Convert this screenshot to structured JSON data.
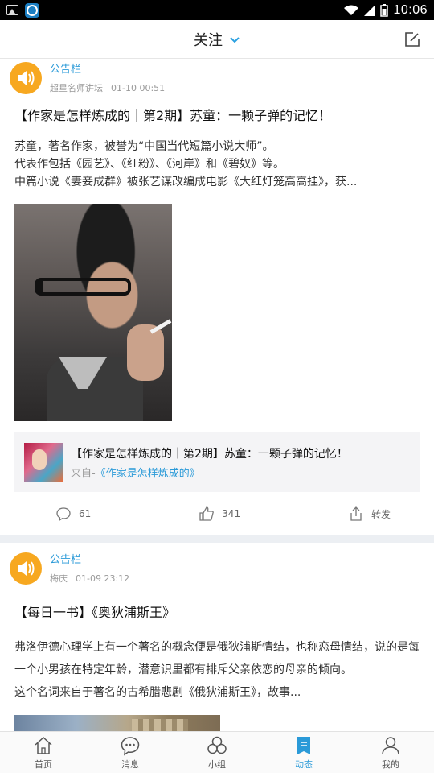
{
  "status_bar": {
    "time": "10:06"
  },
  "header": {
    "title": "关注"
  },
  "posts": [
    {
      "channel": "公告栏",
      "author": "超星名师讲坛",
      "time": "01-10 00:51",
      "title": "【作家是怎样炼成的｜第2期】苏童：一颗子弹的记忆！",
      "body": [
        "苏童，著名作家，被誉为“中国当代短篇小说大师”。",
        "代表作包括《园艺》、《红粉》、《河岸》和《碧奴》等。",
        "中篇小说《妻妾成群》被张艺谋改编成电影《大红灯笼高高挂》，获..."
      ],
      "quote": {
        "title": "【作家是怎样炼成的｜第2期】苏童：一颗子弹的记忆！",
        "from_prefix": "来自-",
        "from_link": "《作家是怎样炼成的》"
      },
      "comments": "61",
      "likes": "341",
      "share": "转发"
    },
    {
      "channel": "公告栏",
      "author": "梅庆",
      "time": "01-09 23:12",
      "title": "【每日一书】《奥狄浦斯王》",
      "body": [
        "弗洛伊德心理学上有一个著名的概念便是俄狄浦斯情结，也称恋母情结，说的是每一个小男孩在特定年龄，潜意识里都有排斥父亲依恋的母亲的倾向。",
        "这个名词来自于著名的古希腊悲剧《俄狄浦斯王》，故事..."
      ]
    }
  ],
  "tabs": [
    {
      "label": "首页",
      "icon": "home-icon"
    },
    {
      "label": "消息",
      "icon": "message-icon"
    },
    {
      "label": "小组",
      "icon": "group-icon"
    },
    {
      "label": "动态",
      "icon": "feed-icon",
      "active": true
    },
    {
      "label": "我的",
      "icon": "profile-icon"
    }
  ],
  "colors": {
    "accent": "#2a9ad8",
    "avatar": "#f7a820"
  }
}
